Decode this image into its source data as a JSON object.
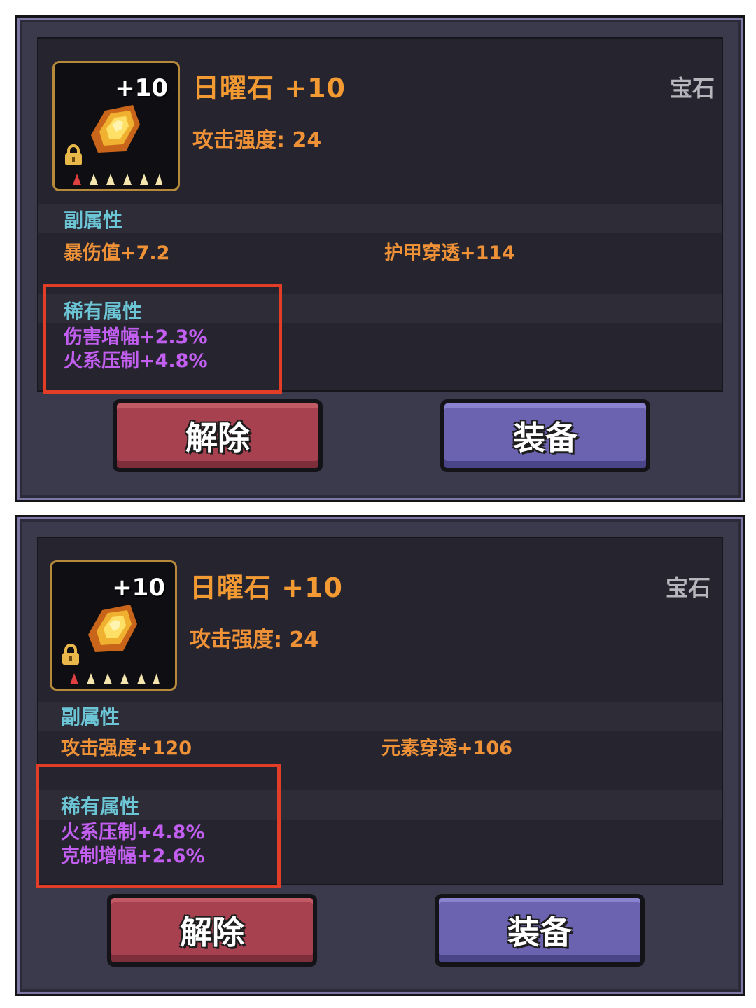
{
  "cards": [
    {
      "item_name": "日曜石 +10",
      "enhance_level": "+10",
      "item_type": "宝石",
      "main_stat": "攻击强度: 24",
      "sub_attributes_label": "副属性",
      "sub_attributes": [
        "暴伤值+7.2",
        "护甲穿透+114"
      ],
      "rare_attributes_label": "稀有属性",
      "rare_attributes": [
        "伤害增幅+2.3%",
        "火系压制+4.8%"
      ],
      "unequip_button": "解除",
      "equip_button": "装备"
    },
    {
      "item_name": "日曜石 +10",
      "enhance_level": "+10",
      "item_type": "宝石",
      "main_stat": "攻击强度: 24",
      "sub_attributes_label": "副属性",
      "sub_attributes": [
        "攻击强度+120",
        "元素穿透+106"
      ],
      "rare_attributes_label": "稀有属性",
      "rare_attributes": [
        "火系压制+4.8%",
        "克制增幅+2.6%"
      ],
      "unequip_button": "解除",
      "equip_button": "装备"
    }
  ],
  "colors": {
    "panel": "#3a3a4c",
    "inner": "#26252f",
    "item_name": "#f39a33",
    "section_label": "#6cc5d4",
    "rare_text": "#c25ef0",
    "highlight_border": "#e23d27",
    "unequip_button": "#a7414f",
    "equip_button": "#6b63b0"
  },
  "icons": {
    "item": "sunstone-gem-icon",
    "lock": "lock-icon",
    "stars": "star-rating-icon"
  }
}
